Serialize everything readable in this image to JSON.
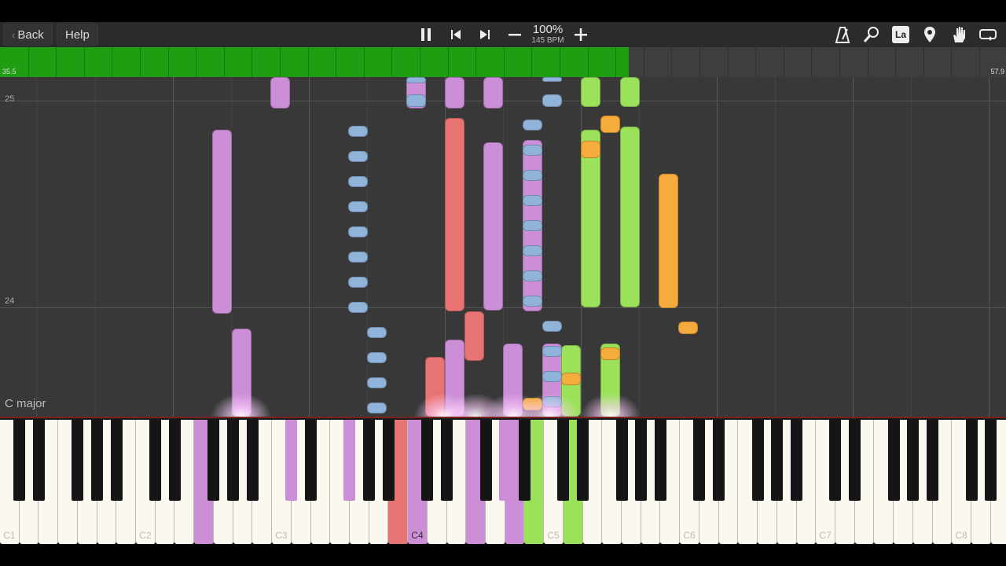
{
  "toolbar": {
    "back_label": "Back",
    "help_label": "Help",
    "tempo_percent": "100%",
    "tempo_bpm": "145 BPM",
    "icons": [
      "pause-icon",
      "skip-back-icon",
      "skip-forward-icon",
      "minus-icon",
      "plus-icon",
      "metronome-icon",
      "search-icon",
      "label-icon",
      "location-pin-icon",
      "hand-icon",
      "loop-icon"
    ],
    "label_icon_text": "La"
  },
  "progress": {
    "start_label": "35.5",
    "end_label": "57.9",
    "progress_fraction": 0.625,
    "fill_color": "#1f9e12"
  },
  "roll": {
    "measures": [
      "25",
      "24"
    ],
    "key_signature": "C major",
    "colors": {
      "pink": "#cc8ed6",
      "blue": "#8fb3d9",
      "red": "#e87373",
      "green": "#9be25a",
      "orange": "#f5ac3c"
    }
  },
  "keyboard": {
    "octave_labels": [
      "C1",
      "C2",
      "C3",
      "C4",
      "C5",
      "C6",
      "C7",
      "C8"
    ]
  }
}
